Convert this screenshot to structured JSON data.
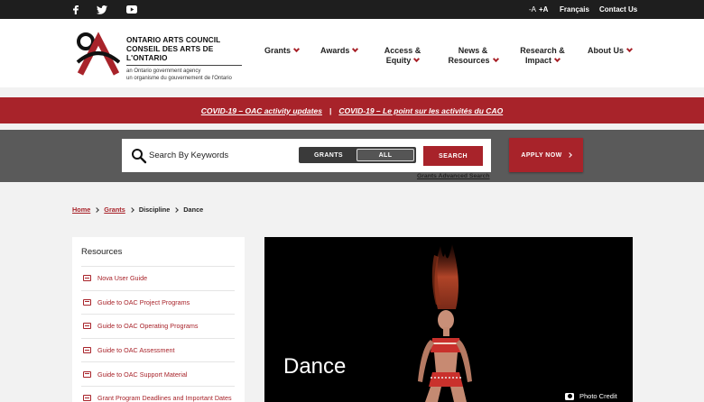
{
  "topbar": {
    "social": [
      {
        "name": "facebook-icon",
        "glyph": "f"
      },
      {
        "name": "twitter-icon",
        "glyph": "t"
      },
      {
        "name": "youtube-icon",
        "glyph": "y"
      }
    ],
    "font_smaller": "-A",
    "font_larger": "+A",
    "language": "Français",
    "contact": "Contact Us"
  },
  "logo": {
    "line1": "ONTARIO ARTS COUNCIL",
    "line2": "CONSEIL DES ARTS DE L'ONTARIO",
    "sub1": "an Ontario government agency",
    "sub2": "un organisme du gouvernement de l'Ontario"
  },
  "nav": [
    {
      "line1": "Grants",
      "line2": ""
    },
    {
      "line1": "Awards",
      "line2": ""
    },
    {
      "line1": "Access &",
      "line2": "Equity"
    },
    {
      "line1": "News &",
      "line2": "Resources"
    },
    {
      "line1": "Research &",
      "line2": "Impact"
    },
    {
      "line1": "About Us",
      "line2": ""
    }
  ],
  "covid": {
    "en": "COVID-19 – OAC activity updates",
    "separator": "|",
    "fr": "COVID-19 – Le point sur les activités du CAO"
  },
  "search": {
    "placeholder": "Search By Keywords",
    "toggle_grants": "GRANTS",
    "toggle_all": "ALL",
    "button": "SEARCH",
    "advanced": "Grants Advanced Search"
  },
  "apply_button": "APPLY NOW",
  "breadcrumb": {
    "home": "Home",
    "grants": "Grants",
    "discipline": "Discipline",
    "current": "Dance"
  },
  "resources": {
    "title": "Resources",
    "items": [
      "Nova User Guide",
      "Guide to OAC Project Programs",
      "Guide to OAC Operating Programs",
      "Guide to OAC Assessment",
      "Guide to OAC Support Material",
      "Grant Program Deadlines and Important Dates"
    ]
  },
  "hero": {
    "title": "Dance",
    "photo_credit": "Photo Credit"
  },
  "colors": {
    "brand_red": "#a8232a",
    "topbar": "#1e1e1e",
    "search_band": "#5a5a5a"
  }
}
